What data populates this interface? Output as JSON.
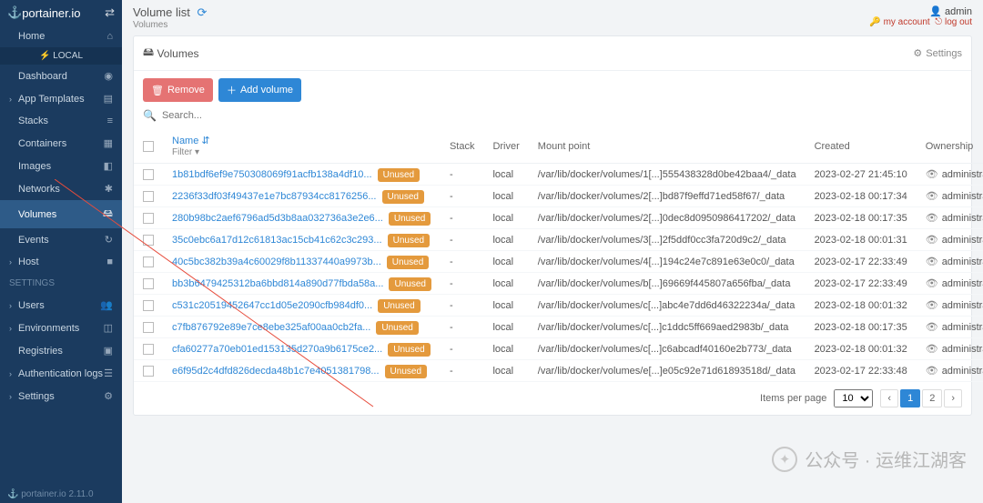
{
  "brand": {
    "name": "portainer.io",
    "footer": "portainer.io    2.11.0"
  },
  "sidebar": {
    "home": "Home",
    "env": "LOCAL",
    "items": [
      "Dashboard",
      "App Templates",
      "Stacks",
      "Containers",
      "Images",
      "Networks",
      "Volumes",
      "Events",
      "Host"
    ],
    "settings_cat": "SETTINGS",
    "settings_items": [
      "Users",
      "Environments",
      "Registries",
      "Authentication logs",
      "Settings"
    ]
  },
  "header": {
    "title": "Volume list",
    "crumb": "Volumes",
    "user_label": "admin",
    "my_account": "my account",
    "logout": "log out"
  },
  "panel": {
    "title": "Volumes",
    "settings": "Settings",
    "remove": "Remove",
    "add": "Add volume",
    "search_placeholder": "Search...",
    "cols": {
      "name": "Name",
      "stack": "Stack",
      "driver": "Driver",
      "mount": "Mount point",
      "created": "Created",
      "ownership": "Ownership"
    },
    "filter": "Filter",
    "unused": "Unused",
    "owner": "administrators",
    "ipp_label": "Items per page",
    "ipp_value": "10"
  },
  "rows": [
    {
      "name": "1b81bdf6ef9e750308069f91acfb138a4df10...",
      "mount": "/var/lib/docker/volumes/1[...]555438328d0be42baa4/_data",
      "created": "2023-02-27 21:45:10"
    },
    {
      "name": "2236f33df03f49437e1e7bc87934cc8176256...",
      "mount": "/var/lib/docker/volumes/2[...]bd87f9effd71ed58f67/_data",
      "created": "2023-02-18 00:17:34"
    },
    {
      "name": "280b98bc2aef6796ad5d3b8aa032736a3e2e6...",
      "mount": "/var/lib/docker/volumes/2[...]0dec8d0950986417202/_data",
      "created": "2023-02-18 00:17:35"
    },
    {
      "name": "35c0ebc6a17d12c61813ac15cb41c62c3c293...",
      "mount": "/var/lib/docker/volumes/3[...]2f5ddf0cc3fa720d9c2/_data",
      "created": "2023-02-18 00:01:31"
    },
    {
      "name": "40c5bc382b39a4c60029f8b11337440a9973b...",
      "mount": "/var/lib/docker/volumes/4[...]194c24e7c891e63e0c0/_data",
      "created": "2023-02-17 22:33:49"
    },
    {
      "name": "bb3b6479425312ba6bbd814a890d77fbda58a...",
      "mount": "/var/lib/docker/volumes/b[...]69669f445807a656fba/_data",
      "created": "2023-02-17 22:33:49"
    },
    {
      "name": "c531c20519452647cc1d05e2090cfb984df0...",
      "mount": "/var/lib/docker/volumes/c[...]abc4e7dd6d46322234a/_data",
      "created": "2023-02-18 00:01:32"
    },
    {
      "name": "c7fb876792e89e7ce8ebe325af00aa0cb2fa...",
      "mount": "/var/lib/docker/volumes/c[...]c1ddc5ff669aed2983b/_data",
      "created": "2023-02-18 00:17:35"
    },
    {
      "name": "cfa60277a70eb01ed153135d270a9b6175ce2...",
      "mount": "/var/lib/docker/volumes/c[...]c6abcadf40160e2b773/_data",
      "created": "2023-02-18 00:01:32"
    },
    {
      "name": "e6f95d2c4dfd826decda48b1c7e4051381798...",
      "mount": "/var/lib/docker/volumes/e[...]e05c92e71d61893518d/_data",
      "created": "2023-02-17 22:33:48"
    }
  ],
  "pages": [
    "1",
    "2"
  ],
  "watermark": "公众号 · 运维江湖客"
}
